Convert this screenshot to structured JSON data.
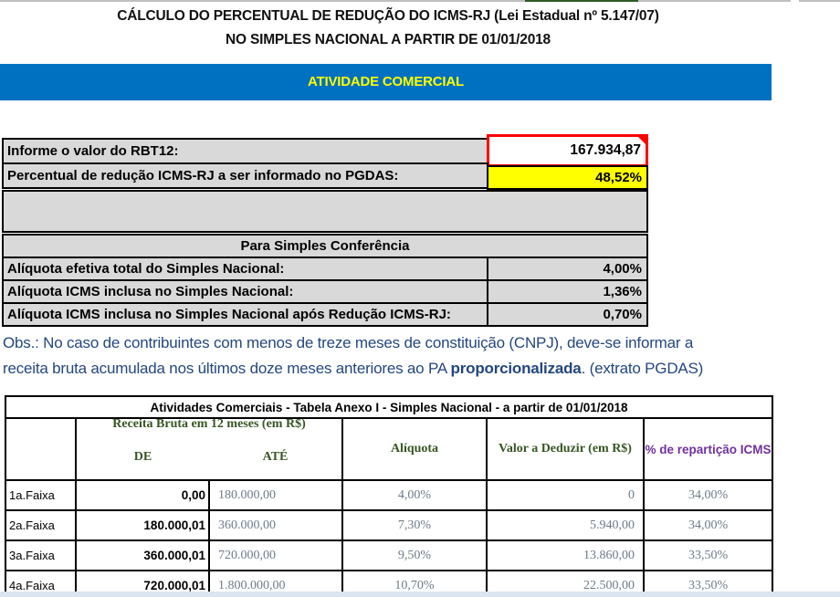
{
  "header": {
    "title_line1": "CÁLCULO DO PERCENTUAL DE REDUÇÃO DO ICMS-RJ (Lei Estadual nº 5.147/07)",
    "title_line2": "NO SIMPLES NACIONAL A PARTIR DE 01/01/2018",
    "banner": "ATIVIDADE COMERCIAL"
  },
  "calculator": {
    "rbt12_label": "Informe o valor do RBT12:",
    "rbt12_value": "167.934,87",
    "reduction_label": "Percentual de redução ICMS-RJ a ser informado no PGDAS:",
    "reduction_value": "48,52%",
    "conference_title": "Para Simples Conferência",
    "conference_rows": [
      {
        "label": "Alíquota efetiva total do Simples Nacional:",
        "value": "4,00%"
      },
      {
        "label": "Alíquota ICMS inclusa no Simples Nacional:",
        "value": "1,36%"
      },
      {
        "label": "Alíquota ICMS inclusa no Simples Nacional após Redução ICMS-RJ:",
        "value": "0,70%"
      }
    ]
  },
  "note": {
    "line1": "Obs.: No caso de contribuintes com menos de treze meses de constituição (CNPJ), deve-se informar a",
    "line2_prefix": "receita bruta acumulada nos últimos doze meses anteriores ao PA ",
    "line2_bold": "proporcionalizada",
    "line2_suffix": ". (extrato PGDAS)"
  },
  "table": {
    "title": "Atividades Comerciais - Tabela Anexo I - Simples Nacional - a partir de 01/01/2018",
    "headers": {
      "receita": "Receita Bruta em 12 meses (em R$)",
      "de": "DE",
      "ate": "ATÉ",
      "aliquota": "Alíquota",
      "deduzir": "Valor a Deduzir (em R$)",
      "reparticao": "% de repartição ICMS"
    },
    "rows": [
      {
        "faixa": "1a.Faixa",
        "de": "0,00",
        "ate": "180.000,00",
        "aliquota": "4,00%",
        "deduzir": "0",
        "reparticao": "34,00%"
      },
      {
        "faixa": "2a.Faixa",
        "de": "180.000,01",
        "ate": "360.000,00",
        "aliquota": "7,30%",
        "deduzir": "5.940,00",
        "reparticao": "34,00%"
      },
      {
        "faixa": "3a.Faixa",
        "de": "360.000,01",
        "ate": "720.000,00",
        "aliquota": "9,50%",
        "deduzir": "13.860,00",
        "reparticao": "33,50%"
      },
      {
        "faixa": "4a.Faixa",
        "de": "720.000,01",
        "ate": "1.800.000,00",
        "aliquota": "10,70%",
        "deduzir": "22.500,00",
        "reparticao": "33,50%"
      }
    ]
  },
  "colors": {
    "banner_bg": "#0070c0",
    "banner_text": "#ffff00",
    "cell_gray": "#d9d9d9",
    "input_border_red": "#fe0000",
    "result_yellow": "#ffff00",
    "note_blue": "#24477f",
    "table_header_green": "#375623",
    "table_header_purple": "#7030a0",
    "table_value_gray": "#6e7b89",
    "bottom_strip": "#dbe5f1"
  }
}
